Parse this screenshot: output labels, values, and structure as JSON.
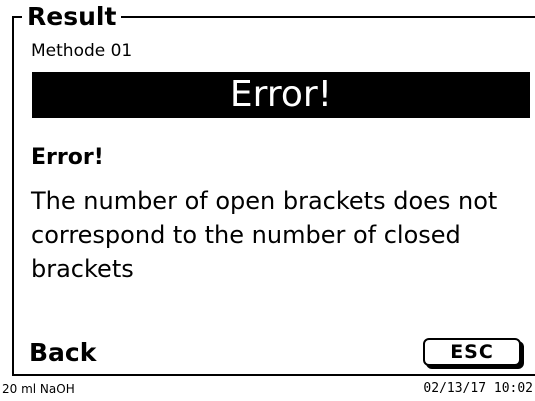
{
  "frame": {
    "title": "Result",
    "method": "Methode 01"
  },
  "error": {
    "banner": "Error!",
    "heading": "Error!",
    "message": "The number of open brackets does not correspond to the number of closed brackets"
  },
  "footer": {
    "back_label": "Back",
    "esc_label": "ESC"
  },
  "status_bar": {
    "reagent": "20 ml NaOH",
    "datetime": "02/13/17 10:02"
  }
}
